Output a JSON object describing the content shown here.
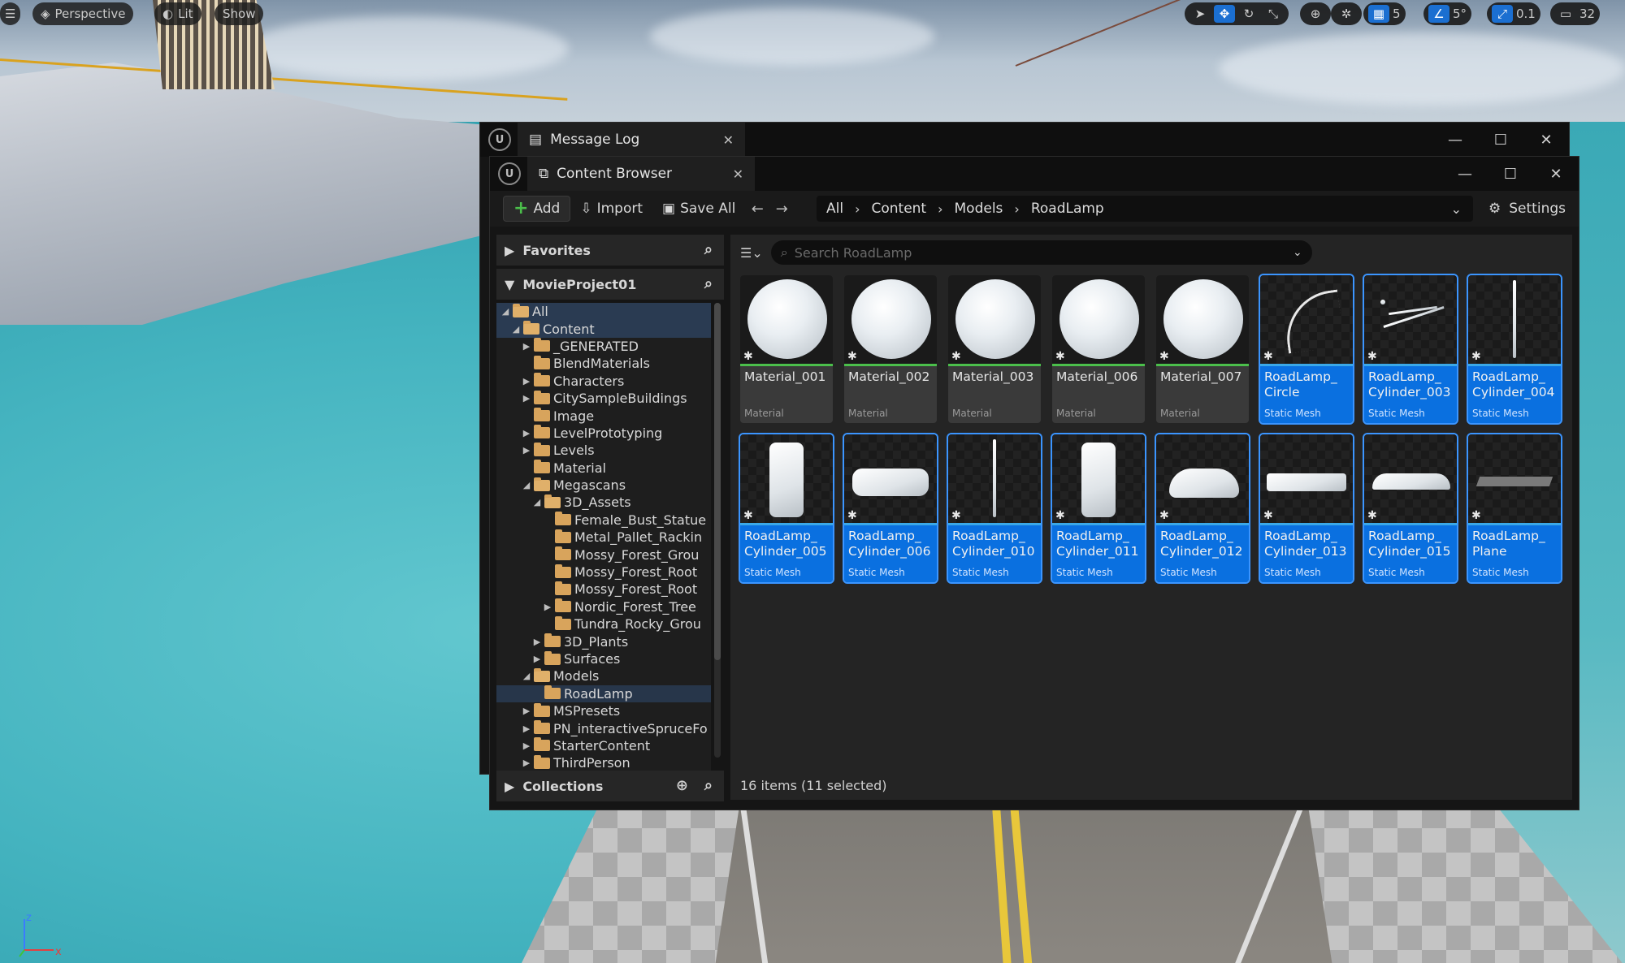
{
  "viewport_toolbar": {
    "menu_icon": "hamburger-icon",
    "perspective": "Perspective",
    "lit": "Lit",
    "show": "Show",
    "grid_snap": "5",
    "angle_snap": "5°",
    "scale_snap": "0.1",
    "camera_speed": "32"
  },
  "message_log": {
    "tab_title": "Message Log"
  },
  "content_browser": {
    "tab_title": "Content Browser",
    "toolbar": {
      "add": "Add",
      "import": "Import",
      "save_all": "Save All",
      "settings": "Settings"
    },
    "breadcrumbs": [
      "All",
      "Content",
      "Models",
      "RoadLamp"
    ],
    "favorites_label": "Favorites",
    "project_label": "MovieProject01",
    "collections_label": "Collections",
    "search_placeholder": "Search RoadLamp",
    "tree": [
      {
        "label": "All",
        "depth": 0,
        "expand": "open",
        "open": true
      },
      {
        "label": "Content",
        "depth": 1,
        "expand": "open",
        "open": true
      },
      {
        "label": "_GENERATED",
        "depth": 2,
        "expand": "closed",
        "open": false
      },
      {
        "label": "BlendMaterials",
        "depth": 2,
        "expand": "none",
        "open": false
      },
      {
        "label": "Characters",
        "depth": 2,
        "expand": "closed",
        "open": false
      },
      {
        "label": "CitySampleBuildings",
        "depth": 2,
        "expand": "closed",
        "open": false
      },
      {
        "label": "Image",
        "depth": 2,
        "expand": "none",
        "open": false
      },
      {
        "label": "LevelPrototyping",
        "depth": 2,
        "expand": "closed",
        "open": false
      },
      {
        "label": "Levels",
        "depth": 2,
        "expand": "closed",
        "open": false
      },
      {
        "label": "Material",
        "depth": 2,
        "expand": "none",
        "open": false
      },
      {
        "label": "Megascans",
        "depth": 2,
        "expand": "open",
        "open": true
      },
      {
        "label": "3D_Assets",
        "depth": 3,
        "expand": "open",
        "open": true
      },
      {
        "label": "Female_Bust_Statue",
        "depth": 4,
        "expand": "none",
        "open": false
      },
      {
        "label": "Metal_Pallet_Rackin",
        "depth": 4,
        "expand": "none",
        "open": false
      },
      {
        "label": "Mossy_Forest_Grou",
        "depth": 4,
        "expand": "none",
        "open": false
      },
      {
        "label": "Mossy_Forest_Root",
        "depth": 4,
        "expand": "none",
        "open": false
      },
      {
        "label": "Mossy_Forest_Root",
        "depth": 4,
        "expand": "none",
        "open": false
      },
      {
        "label": "Nordic_Forest_Tree",
        "depth": 4,
        "expand": "closed",
        "open": false
      },
      {
        "label": "Tundra_Rocky_Grou",
        "depth": 4,
        "expand": "none",
        "open": false
      },
      {
        "label": "3D_Plants",
        "depth": 3,
        "expand": "closed",
        "open": false
      },
      {
        "label": "Surfaces",
        "depth": 3,
        "expand": "closed",
        "open": false
      },
      {
        "label": "Models",
        "depth": 2,
        "expand": "open",
        "open": true
      },
      {
        "label": "RoadLamp",
        "depth": 3,
        "expand": "none",
        "open": false,
        "selected": true
      },
      {
        "label": "MSPresets",
        "depth": 2,
        "expand": "closed",
        "open": false
      },
      {
        "label": "PN_interactiveSpruceFo",
        "depth": 2,
        "expand": "closed",
        "open": false
      },
      {
        "label": "StarterContent",
        "depth": 2,
        "expand": "closed",
        "open": false
      },
      {
        "label": "ThirdPerson",
        "depth": 2,
        "expand": "closed",
        "open": false
      }
    ],
    "assets": [
      {
        "name": "Material_001",
        "type": "Material",
        "kind": "material",
        "selected": false,
        "shape": "sphere"
      },
      {
        "name": "Material_002",
        "type": "Material",
        "kind": "material",
        "selected": false,
        "shape": "sphere"
      },
      {
        "name": "Material_003",
        "type": "Material",
        "kind": "material",
        "selected": false,
        "shape": "sphere"
      },
      {
        "name": "Material_006",
        "type": "Material",
        "kind": "material",
        "selected": false,
        "shape": "sphere"
      },
      {
        "name": "Material_007",
        "type": "Material",
        "kind": "material",
        "selected": false,
        "shape": "sphere"
      },
      {
        "name": "RoadLamp_ Circle",
        "type": "Static Mesh",
        "kind": "mesh",
        "selected": true,
        "shape": "arc"
      },
      {
        "name": "RoadLamp_ Cylinder_003",
        "type": "Static Mesh",
        "kind": "mesh",
        "selected": true,
        "shape": "strokes"
      },
      {
        "name": "RoadLamp_ Cylinder_004",
        "type": "Static Mesh",
        "kind": "mesh",
        "selected": true,
        "shape": "pole"
      },
      {
        "name": "RoadLamp_ Cylinder_005",
        "type": "Static Mesh",
        "kind": "mesh",
        "selected": true,
        "shape": "tall-box"
      },
      {
        "name": "RoadLamp_ Cylinder_006",
        "type": "Static Mesh",
        "kind": "mesh",
        "selected": true,
        "shape": "wide-box"
      },
      {
        "name": "RoadLamp_ Cylinder_010",
        "type": "Static Mesh",
        "kind": "mesh",
        "selected": true,
        "shape": "pole"
      },
      {
        "name": "RoadLamp_ Cylinder_011",
        "type": "Static Mesh",
        "kind": "mesh",
        "selected": true,
        "shape": "tall-box"
      },
      {
        "name": "RoadLamp_ Cylinder_012",
        "type": "Static Mesh",
        "kind": "mesh",
        "selected": true,
        "shape": "dome"
      },
      {
        "name": "RoadLamp_ Cylinder_013",
        "type": "Static Mesh",
        "kind": "mesh",
        "selected": true,
        "shape": "bar"
      },
      {
        "name": "RoadLamp_ Cylinder_015",
        "type": "Static Mesh",
        "kind": "mesh",
        "selected": true,
        "shape": "flat-dome"
      },
      {
        "name": "RoadLamp_ Plane",
        "type": "Static Mesh",
        "kind": "mesh",
        "selected": true,
        "shape": "plane"
      }
    ],
    "status": "16 items (11 selected)"
  },
  "colors": {
    "selection_blue": "#0a70e0",
    "material_underline": "#4bbf4b",
    "mesh_underline": "#3aa8e8",
    "folder": "#d8a45c"
  }
}
